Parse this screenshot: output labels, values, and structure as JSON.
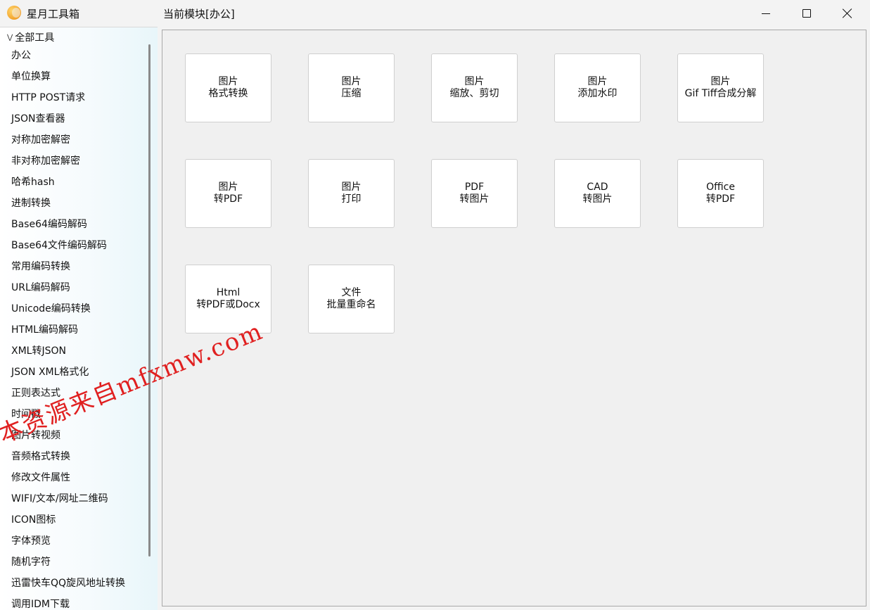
{
  "app": {
    "title": "星月工具箱",
    "module_title": "当前模块[办公]"
  },
  "sidebar": {
    "root_label": "全部工具",
    "items": [
      "办公",
      "单位换算",
      "HTTP POST请求",
      "JSON查看器",
      "对称加密解密",
      "非对称加密解密",
      "哈希hash",
      "进制转换",
      "Base64编码解码",
      "Base64文件编码解码",
      "常用编码转换",
      "URL编码解码",
      "Unicode编码转换",
      "HTML编码解码",
      "XML转JSON",
      "JSON XML格式化",
      "正则表达式",
      "时间戳",
      "图片转视频",
      "音频格式转换",
      "修改文件属性",
      "WIFI/文本/网址二维码",
      "ICON图标",
      "字体预览",
      "随机字符",
      "迅雷快车QQ旋风地址转换",
      "调用IDM下载"
    ]
  },
  "tools": [
    {
      "line1": "图片",
      "line2": "格式转换"
    },
    {
      "line1": "图片",
      "line2": "压缩"
    },
    {
      "line1": "图片",
      "line2": "缩放、剪切"
    },
    {
      "line1": "图片",
      "line2": "添加水印"
    },
    {
      "line1": "图片",
      "line2": "Gif Tiff合成分解"
    },
    {
      "line1": "图片",
      "line2": "转PDF"
    },
    {
      "line1": "图片",
      "line2": "打印"
    },
    {
      "line1": "PDF",
      "line2": "转图片"
    },
    {
      "line1": "CAD",
      "line2": "转图片"
    },
    {
      "line1": "Office",
      "line2": "转PDF"
    },
    {
      "line1": "Html",
      "line2": "转PDF或Docx"
    },
    {
      "line1": "文件",
      "line2": "批量重命名"
    }
  ],
  "watermark": {
    "text": "本资源来自mfxmw.com",
    "color": "#e02020"
  },
  "icons": {
    "app": "moon-star-icon",
    "minimize": "minimize-icon",
    "maximize": "maximize-icon",
    "close": "close-icon",
    "tree_toggle": "chevron-down-icon"
  }
}
